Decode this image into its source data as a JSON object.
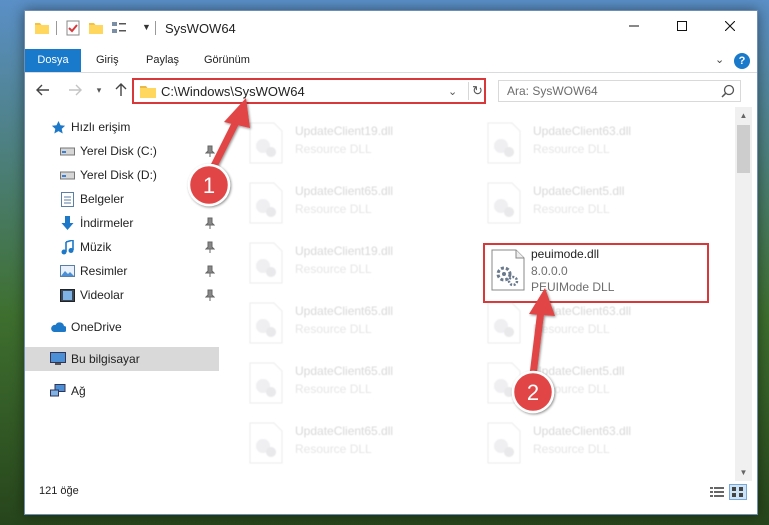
{
  "window": {
    "title": "SysWOW64"
  },
  "ribbon": {
    "tabs": [
      "Dosya",
      "Giriş",
      "Paylaş",
      "Görünüm"
    ],
    "help": "?"
  },
  "address": {
    "path": "C:\\Windows\\SysWOW64"
  },
  "search": {
    "placeholder": "Ara: SysWOW64"
  },
  "sidebar": {
    "items": [
      {
        "label": "Hızlı erişim",
        "icon": "star-icon"
      },
      {
        "label": "Yerel Disk (C:)",
        "icon": "drive-icon",
        "pinned": true
      },
      {
        "label": "Yerel Disk (D:)",
        "icon": "drive-icon",
        "pinned": true
      },
      {
        "label": "Belgeler",
        "icon": "documents-icon",
        "pinned": true
      },
      {
        "label": "İndirmeler",
        "icon": "download-icon",
        "pinned": true
      },
      {
        "label": "Müzik",
        "icon": "music-icon",
        "pinned": true
      },
      {
        "label": "Resimler",
        "icon": "pictures-icon",
        "pinned": true
      },
      {
        "label": "Videolar",
        "icon": "videos-icon",
        "pinned": true
      },
      {
        "label": "OneDrive",
        "icon": "cloud-icon"
      },
      {
        "label": "Bu bilgisayar",
        "icon": "computer-icon",
        "selected": true
      },
      {
        "label": "Ağ",
        "icon": "network-icon"
      }
    ]
  },
  "files": [
    {
      "name": "UpdateClient19.dll",
      "type": "Resource DLL"
    },
    {
      "name": "UpdateClient63.dll",
      "type": "Resource DLL"
    },
    {
      "name": "UpdateClient65.dll",
      "type": "Resource DLL"
    },
    {
      "name": "UpdateClient5.dll",
      "type": "Resource DLL"
    },
    {
      "name": "UpdateClient19.dll",
      "type": "Resource DLL"
    },
    {
      "name": "peuimode.dll",
      "version": "8.0.0.0",
      "type": "PEUIMode DLL"
    },
    {
      "name": "UpdateClient65.dll",
      "type": "Resource DLL"
    },
    {
      "name": "UpdateClient63.dll",
      "type": "Resource DLL"
    },
    {
      "name": "UpdateClient65.dll",
      "type": "Resource DLL"
    },
    {
      "name": "UpdateClient5.dll",
      "type": "Resource DLL"
    },
    {
      "name": "UpdateClient65.dll",
      "type": "Resource DLL"
    },
    {
      "name": "UpdateClient63.dll",
      "type": "Resource DLL"
    }
  ],
  "status": {
    "count": "121 öğe"
  },
  "annotations": {
    "step1": "1",
    "step2": "2",
    "color": "#e14444"
  }
}
